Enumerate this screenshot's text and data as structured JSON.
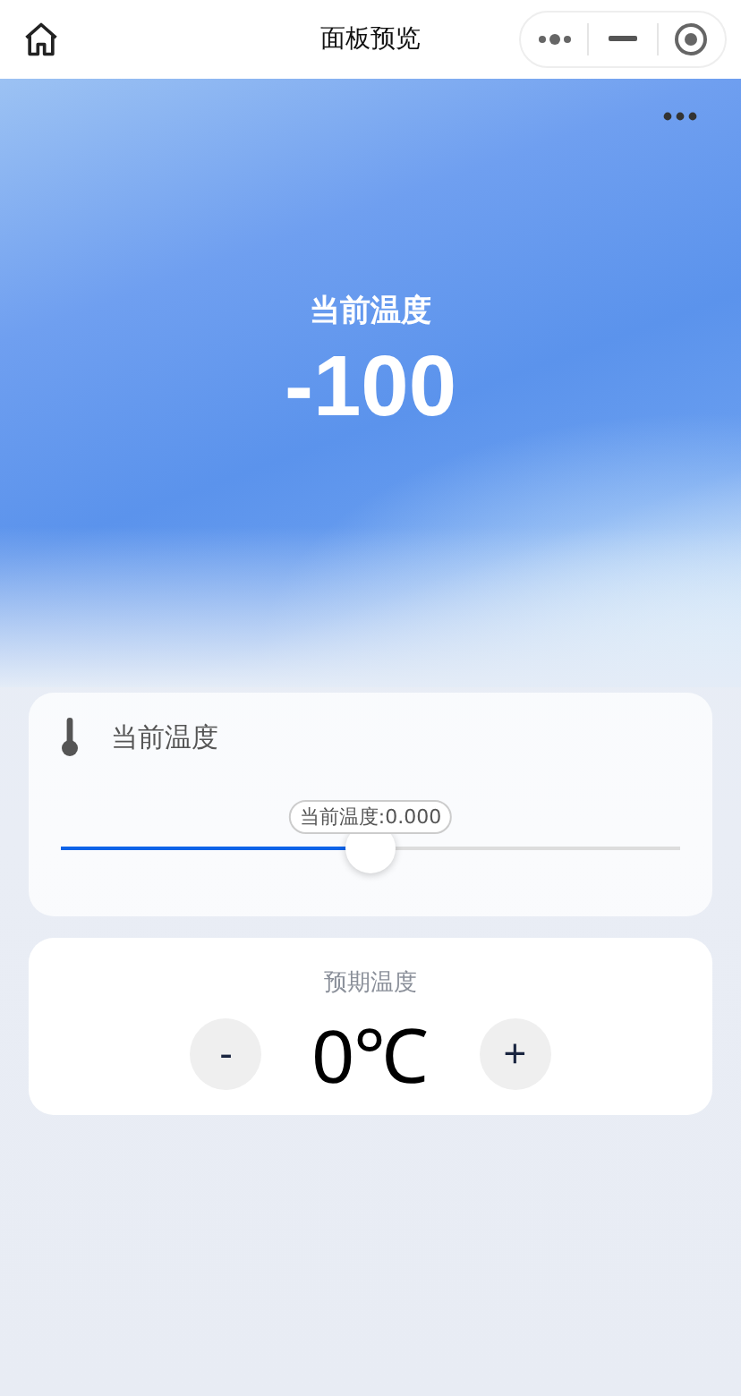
{
  "window": {
    "title": "面板预览"
  },
  "hero": {
    "label": "当前温度",
    "value": "-100"
  },
  "sensor_card": {
    "title": "当前温度",
    "slider": {
      "tooltip": "当前温度:0.000",
      "level": 0.5
    }
  },
  "setpoint_card": {
    "title": "预期温度",
    "decrease": "-",
    "value": "0℃",
    "increase": "+"
  }
}
